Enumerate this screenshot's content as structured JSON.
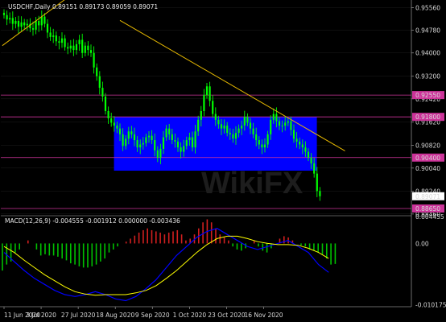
{
  "header": {
    "main_title": "USDCHF,Daily  0.89151 0.89173 0.89059 0.89071",
    "macd_title": "MACD(12,26,9) -0.004555 -0.001912 0.000000 -0.003436"
  },
  "watermark": "WikiFX",
  "colors": {
    "background": "#000000",
    "bull": "#00ff00",
    "bear": "#00ff00",
    "channel": "#0000ff",
    "trendline": "#e6b800",
    "hlines": "#cc3399",
    "grid": "#1e1e1e",
    "axis_text": "#d8d8d8",
    "macd_line": "#0000ff",
    "signal_line": "#ffff00",
    "hist_pos": "#d11f1f",
    "hist_neg": "#00c000"
  },
  "chart_data": [
    {
      "type": "candlestick",
      "title": "USDCHF,Daily",
      "ylim": [
        0.884,
        0.9582
      ],
      "yticks": [
        0.9556,
        0.9478,
        0.94,
        0.932,
        0.9242,
        0.9162,
        0.9082,
        0.9004,
        0.8924,
        0.8846
      ],
      "x_labels": [
        "11 Jun 2020",
        "3 Jul 2020",
        "27 Jul 2020",
        "18 Aug 2020",
        "9 Sep 2020",
        "1 Oct 2020",
        "23 Oct 2020",
        "16 Nov 2020"
      ],
      "x_label_index": [
        0,
        16,
        32,
        48,
        64,
        80,
        96,
        112
      ],
      "last_price": "0.89071",
      "hlines": [
        {
          "label": "0.92550",
          "value": 0.9255
        },
        {
          "label": "0.91800",
          "value": 0.918
        },
        {
          "label": "0.90400",
          "value": 0.904
        },
        {
          "label": "0.88650",
          "value": 0.8865
        }
      ],
      "channel": {
        "x0_index": 64.5,
        "x1_index": 183.5,
        "top": 0.918,
        "bottom": 0.8995
      },
      "trendlines": [
        {
          "from": [
            -1,
            0.9425
          ],
          "to": [
            36,
            0.9585
          ]
        },
        {
          "from": [
            68,
            0.9512
          ],
          "to": [
            200,
            0.9063
          ]
        }
      ],
      "closes": [
        0.953,
        0.9515,
        0.952,
        0.95,
        0.951,
        0.949,
        0.9505,
        0.9495,
        0.95,
        0.9485,
        0.948,
        0.951,
        0.9495,
        0.9525,
        0.95,
        0.947,
        0.9455,
        0.946,
        0.944,
        0.9435,
        0.945,
        0.942,
        0.9415,
        0.9425,
        0.941,
        0.943,
        0.9445,
        0.94,
        0.9425,
        0.941,
        0.94,
        0.935,
        0.932,
        0.928,
        0.925,
        0.92,
        0.9175,
        0.916,
        0.915,
        0.914,
        0.912,
        0.908,
        0.9105,
        0.913,
        0.912,
        0.91,
        0.9075,
        0.9085,
        0.909,
        0.911,
        0.9115,
        0.91,
        0.9065,
        0.904,
        0.907,
        0.911,
        0.914,
        0.912,
        0.91,
        0.9095,
        0.9075,
        0.906,
        0.908,
        0.91,
        0.911,
        0.9075,
        0.913,
        0.917,
        0.92,
        0.9255,
        0.9285,
        0.9235,
        0.919,
        0.917,
        0.9155,
        0.914,
        0.915,
        0.9125,
        0.912,
        0.9105,
        0.9125,
        0.914,
        0.915,
        0.918,
        0.916,
        0.914,
        0.912,
        0.91,
        0.9085,
        0.9075,
        0.9085,
        0.912,
        0.917,
        0.919,
        0.9165,
        0.915,
        0.915,
        0.916,
        0.9165,
        0.9135,
        0.9105,
        0.9095,
        0.9085,
        0.9075,
        0.906,
        0.904,
        0.902,
        0.8985,
        0.8925,
        0.8907
      ],
      "x_index_scale": 1.7
    },
    {
      "type": "macd",
      "title": "MACD(12,26,9)",
      "ylim": [
        -0.0105,
        0.0046
      ],
      "yticks": [
        0.004455,
        0.0,
        -0.010175
      ],
      "ytick_labels": [
        "0.004455",
        "0.00",
        "-0.010175"
      ],
      "histogram": [
        -0.0045,
        -0.0035,
        -0.003,
        -0.0015,
        -0.001,
        0.0,
        0.0005,
        0.0,
        -0.001,
        -0.002,
        -0.0018,
        -0.002,
        -0.002,
        -0.0022,
        -0.0025,
        -0.0028,
        -0.0033,
        -0.0035,
        -0.0038,
        -0.004,
        -0.004,
        -0.0038,
        -0.0035,
        -0.003,
        -0.0025,
        -0.0015,
        -0.001,
        -0.0005,
        0.0,
        0.0003,
        0.0008,
        0.0013,
        0.0018,
        0.0022,
        0.0025,
        0.0022,
        0.002,
        0.0018,
        0.0015,
        0.0018,
        0.002,
        0.0022,
        0.0015,
        0.0005,
        0.0008,
        0.0015,
        0.0025,
        0.0035,
        0.004,
        0.0035,
        0.0025,
        0.0015,
        0.001,
        0.0005,
        -0.0005,
        -0.001,
        -0.0012,
        -0.0008,
        0.0,
        0.0005,
        -0.0005,
        -0.0012,
        -0.0015,
        -0.0008,
        0.0,
        0.0008,
        0.0012,
        0.001,
        0.0005,
        0.0,
        -0.0003,
        -0.0005,
        -0.001,
        -0.0012,
        -0.0015,
        -0.0018,
        -0.0025,
        -0.0035,
        -0.0034
      ],
      "histogram_x_start": 0,
      "histogram_x_step": 2.1,
      "macd": [
        -0.0015,
        -0.003,
        -0.0045,
        -0.0058,
        -0.0068,
        -0.0078,
        -0.0085,
        -0.0088,
        -0.0085,
        -0.008,
        -0.0085,
        -0.0092,
        -0.0095,
        -0.0088,
        -0.0075,
        -0.006,
        -0.004,
        -0.002,
        -0.0005,
        0.001,
        0.002,
        0.0025,
        0.0015,
        0.0005,
        -0.0005,
        -0.001,
        -0.0005,
        0.0,
        0.0005,
        -0.0005,
        -0.0015,
        -0.0035,
        -0.0048
      ],
      "signal": [
        -0.0005,
        -0.0015,
        -0.0028,
        -0.004,
        -0.0052,
        -0.0062,
        -0.0072,
        -0.008,
        -0.0084,
        -0.0086,
        -0.0085,
        -0.0085,
        -0.0085,
        -0.0082,
        -0.0078,
        -0.007,
        -0.0058,
        -0.0045,
        -0.003,
        -0.0015,
        -0.0002,
        0.0008,
        0.0012,
        0.0012,
        0.0008,
        0.0003,
        0.0,
        -0.0002,
        -0.0002,
        -0.0003,
        -0.0008,
        -0.0015,
        -0.0025
      ],
      "line_x_step": 5.2
    }
  ]
}
